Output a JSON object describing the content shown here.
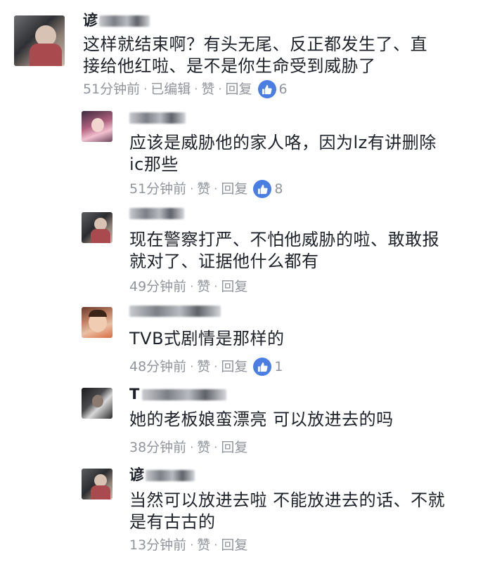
{
  "comments": [
    {
      "name": "谚",
      "text_lines": [
        "这样就结束啊？有头无尾、反正都发生了、直",
        "接给他红啦、是不是你生命受到威胁了"
      ],
      "time": "51分钟前",
      "edited": "已编辑",
      "like": "赞",
      "reply": "回复",
      "likes": "6"
    },
    {
      "name": "",
      "text_lines": [
        "应该是威胁他的家人咯，因为lz有讲删除",
        "ic那些"
      ],
      "time": "51分钟前",
      "like": "赞",
      "reply": "回复",
      "likes": "8"
    },
    {
      "name": "",
      "text_lines": [
        "现在警察打严、不怕他威胁的啦、敢敢报",
        "就对了、证据他什么都有"
      ],
      "time": "49分钟前",
      "like": "赞",
      "reply": "回复"
    },
    {
      "name": "",
      "text_lines": [
        "TVB式剧情是那样的"
      ],
      "time": "48分钟前",
      "like": "赞",
      "reply": "回复",
      "likes": "1"
    },
    {
      "name": "T",
      "text_lines": [
        "她的老板娘蛮漂亮 可以放进去的吗"
      ],
      "time": "38分钟前",
      "like": "赞",
      "reply": "回复"
    },
    {
      "name": "谚",
      "text_lines": [
        "当然可以放进去啦 不能放进去的话、不就",
        "是有古古的"
      ],
      "time": "13分钟前",
      "like": "赞",
      "reply": "回复"
    }
  ],
  "colors": {
    "text": "#1d2129",
    "meta": "#90949c",
    "like_badge": "#4a7ee3"
  },
  "icons": {
    "like": "thumbs-up-icon"
  }
}
